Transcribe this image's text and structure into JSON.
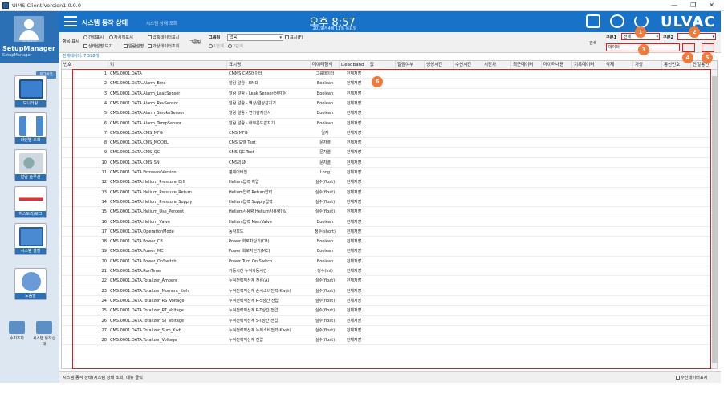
{
  "window": {
    "title": "UIMS Client Version1.0.0.0",
    "min": "—",
    "max": "❐",
    "close": "✕"
  },
  "header": {
    "title": "시스템 동작 상태",
    "subtitle": "시스템 상태 조회",
    "time": "오후 8:57",
    "date": "2019년 4월 11일 목요일",
    "logo": "ULVAC"
  },
  "profile": {
    "user_id": "no-admin",
    "name": "SetupManager",
    "role": "SetupManager",
    "logout": "로그아웃"
  },
  "nav": {
    "items": [
      {
        "label": "모니터링"
      },
      {
        "label": "라인별 조회"
      },
      {
        "label": "알람 솔루션"
      },
      {
        "label": "히스토리/로그"
      },
      {
        "label": "시스템 설정"
      },
      {
        "label": "도움말"
      }
    ],
    "bottom": [
      {
        "label": "수치조회"
      },
      {
        "label": "시스템 동작상태"
      }
    ]
  },
  "filters": {
    "display_label": "항목 표시",
    "opt_brief": "간략표시",
    "opt_detail": "자세히표시",
    "chk_compress": "압축데이터표시",
    "chk_status_view": "상태설명 보기",
    "chk_alarm": "알람설명",
    "chk_virtual": "가상데이터조회",
    "group_label": "그룹핑",
    "group_sel_label": "그룹핑",
    "group_value": "없음",
    "chk_show": "표시(F)",
    "level1": "1단계",
    "level2": "2단계",
    "search_label": "검색",
    "cat1_label": "구분1",
    "cat1_value": "전체",
    "cat2_label": "구분2",
    "cat2_value": "",
    "search_value": "데이터"
  },
  "row_count": "전체데이터: 7,528개",
  "table": {
    "columns": [
      "번호",
      "키",
      "표시명",
      "데이터형식",
      "DeadBand",
      "값",
      "알람여부",
      "생성시간",
      "수신시간",
      "시간차",
      "최근데이터",
      "데이터내용",
      "기록데이터",
      "삭제",
      "가상",
      "통신번호",
      "단일통신"
    ],
    "rows": [
      [
        "1",
        "CMS.0001.DATA",
        "CMMS CMS데이터",
        "그룹데이터",
        "전체저장"
      ],
      [
        "2",
        "CMS.0001.DATA.Alarm_Emo",
        "알람 알람 - EMO",
        "Boolean",
        "전체저장"
      ],
      [
        "3",
        "CMS.0001.DATA.Alarm_LeakSensor",
        "알람 알람 - Leak Sensor(냉각수)",
        "Boolean",
        "전체저장"
      ],
      [
        "4",
        "CMS.0001.DATA.Alarm_RevSensor",
        "알람 알람 - 역상/결상감지기",
        "Boolean",
        "전체저장"
      ],
      [
        "5",
        "CMS.0001.DATA.Alarm_SmokeSensor",
        "알람 알람 - 연기감지센서",
        "Boolean",
        "전체저장"
      ],
      [
        "6",
        "CMS.0001.DATA.Alarm_TempSensor",
        "알람 알람 - 내부온도감지기",
        "Boolean",
        "전체저장"
      ],
      [
        "7",
        "CMS.0001.DATA.CMS_MFG",
        "CMS MFG",
        "일자",
        "전체저장"
      ],
      [
        "8",
        "CMS.0001.DATA.CMS_MODEL",
        "CMS 모델 Text",
        "문자열",
        "전체저장"
      ],
      [
        "9",
        "CMS.0001.DATA.CMS_QC",
        "CMS QC Text",
        "문자열",
        "전체저장"
      ],
      [
        "10",
        "CMS.0001.DATA.CMS_SN",
        "CMS의SN",
        "문자열",
        "전체저장"
      ],
      [
        "11",
        "CMS.0001.DATA.FirmwareVersion",
        "펌웨어버전",
        "Long",
        "전체저장"
      ],
      [
        "12",
        "CMS.0001.DATA.Helium_Pressure_Diff",
        "Helium압력 차압",
        "실수(float)",
        "전체저장"
      ],
      [
        "13",
        "CMS.0001.DATA.Helium_Pressure_Return",
        "Helium압력 Return압력",
        "실수(float)",
        "전체저장"
      ],
      [
        "14",
        "CMS.0001.DATA.Helium_Pressure_Supply",
        "Helium압력 Supply압력",
        "실수(float)",
        "전체저장"
      ],
      [
        "15",
        "CMS.0001.DATA.Helium_Use_Percent",
        "Helium사용량 Helium사용량(%)",
        "실수(float)",
        "전체저장"
      ],
      [
        "16",
        "CMS.0001.DATA.Helium_Valve",
        "Helium압력 MainValve",
        "Boolean",
        "전체저장"
      ],
      [
        "17",
        "CMS.0001.DATA.OperationMode",
        "동작모드",
        "정수(short)",
        "전체저장"
      ],
      [
        "18",
        "CMS.0001.DATA.Power_CB",
        "Power 회로차단기(CB)",
        "Boolean",
        "전체저장"
      ],
      [
        "19",
        "CMS.0001.DATA.Power_MC",
        "Power 회로차단기(MC)",
        "Boolean",
        "전체저장"
      ],
      [
        "20",
        "CMS.0001.DATA.Power_OnSwitch",
        "Power Turn On Switch",
        "Boolean",
        "전체저장"
      ],
      [
        "21",
        "CMS.0001.DATA.RunTime",
        "가동시간 누적가동시간",
        "정수(int)",
        "전체저장"
      ],
      [
        "22",
        "CMS.0001.DATA.Totalizer_Ampere",
        "누적전력적산계 전류(A)",
        "실수(float)",
        "전체저장"
      ],
      [
        "23",
        "CMS.0001.DATA.Totalizer_Moment_Kwh",
        "누적전력적산계 순시소비전력(Kw/h)",
        "실수(float)",
        "전체저장"
      ],
      [
        "24",
        "CMS.0001.DATA.Totalizer_RS_Voltage",
        "누적전력적산계 R-S상간 전압",
        "실수(float)",
        "전체저장"
      ],
      [
        "25",
        "CMS.0001.DATA.Totalizer_RT_Voltage",
        "누적전력적산계 R-T상간 전압",
        "실수(float)",
        "전체저장"
      ],
      [
        "26",
        "CMS.0001.DATA.Totalizer_ST_Voltage",
        "누적전력적산계 S-T상간 전압",
        "실수(float)",
        "전체저장"
      ],
      [
        "27",
        "CMS.0001.DATA.Totalizer_Sum_Kwh",
        "누적전력적산계 누적소비전력(Kw/h)",
        "실수(float)",
        "전체저장"
      ],
      [
        "28",
        "CMS.0001.DATA.Totalizer_Voltage",
        "누적전력적산계 전압",
        "실수(float)",
        "전체저장"
      ]
    ]
  },
  "annotations": [
    "1",
    "2",
    "3",
    "4",
    "5",
    "6"
  ],
  "status": {
    "message": "시스템 동작 상태(시스템 상태 조회) 메뉴 클릭",
    "auto_refresh": "수신데이터표시"
  },
  "colors": {
    "header": "#1873c8",
    "annotation": "#f07a3a",
    "highlight": "#e02020"
  }
}
